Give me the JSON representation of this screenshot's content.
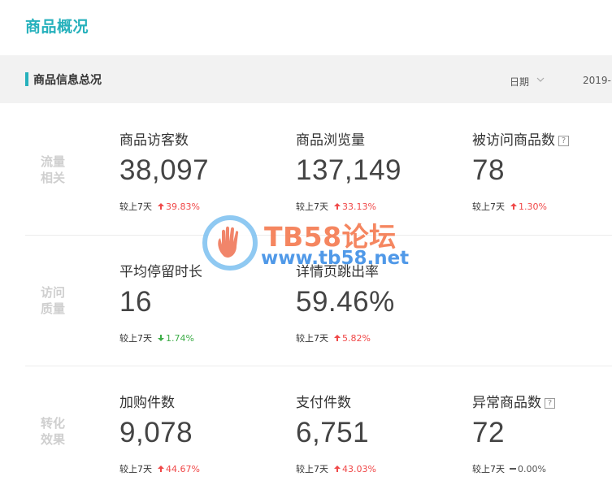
{
  "page": {
    "title": "商品概况"
  },
  "section": {
    "title": "商品信息总况",
    "date_label": "日期",
    "date_value": "2019-"
  },
  "groups": [
    {
      "label_line1": "流量",
      "label_line2": "相关",
      "metrics": [
        {
          "label": "商品访客数",
          "value": "38,097",
          "compare_label": "较上7天",
          "change": "39.83%",
          "trend": "up",
          "help": false
        },
        {
          "label": "商品浏览量",
          "value": "137,149",
          "compare_label": "较上7天",
          "change": "33.13%",
          "trend": "up",
          "help": false
        },
        {
          "label": "被访问商品数",
          "value": "78",
          "compare_label": "较上7天",
          "change": "1.30%",
          "trend": "up",
          "help": true
        }
      ]
    },
    {
      "label_line1": "访问",
      "label_line2": "质量",
      "metrics": [
        {
          "label": "平均停留时长",
          "value": "16",
          "compare_label": "较上7天",
          "change": "1.74%",
          "trend": "down",
          "help": false
        },
        {
          "label": "详情页跳出率",
          "value": "59.46%",
          "compare_label": "较上7天",
          "change": "5.82%",
          "trend": "up",
          "help": false
        }
      ]
    },
    {
      "label_line1": "转化",
      "label_line2": "效果",
      "metrics": [
        {
          "label": "加购件数",
          "value": "9,078",
          "compare_label": "较上7天",
          "change": "44.67%",
          "trend": "up",
          "help": false
        },
        {
          "label": "支付件数",
          "value": "6,751",
          "compare_label": "较上7天",
          "change": "43.03%",
          "trend": "up",
          "help": false
        },
        {
          "label": "异常商品数",
          "value": "72",
          "compare_label": "较上7天",
          "change": "0.00%",
          "trend": "flat",
          "help": true
        }
      ]
    }
  ],
  "help_glyph": "?",
  "watermark": {
    "line1": "TB58论坛",
    "line2": "www.tb58.net"
  },
  "colors": {
    "accent": "#26b1bc",
    "up": "#f04848",
    "down": "#3fae49",
    "watermark_orange": "#f47a4f",
    "watermark_blue": "#3e8fe6"
  },
  "icons": {
    "trend_up": "arrow-up-icon",
    "trend_down": "arrow-down-icon",
    "trend_flat": "dash-icon",
    "help": "question-mark-icon",
    "dropdown": "chevron-down-icon"
  }
}
